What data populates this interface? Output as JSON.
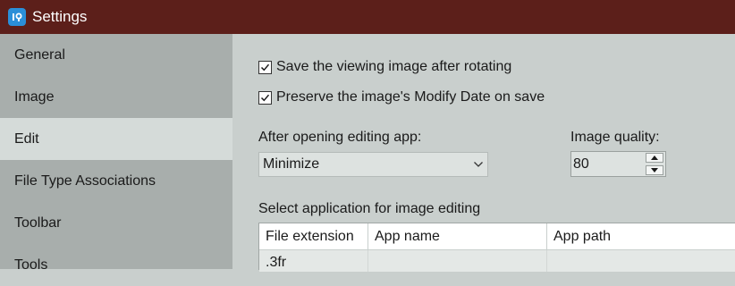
{
  "window": {
    "title": "Settings",
    "icon": "app-logo-icon"
  },
  "sidebar": {
    "items": [
      {
        "label": "General",
        "active": false
      },
      {
        "label": "Image",
        "active": false
      },
      {
        "label": "Edit",
        "active": true
      },
      {
        "label": "File Type Associations",
        "active": false
      },
      {
        "label": "Toolbar",
        "active": false
      },
      {
        "label": "Tools",
        "active": false
      }
    ]
  },
  "edit": {
    "save_after_rotating": {
      "label": "Save the viewing image after rotating",
      "checked": true
    },
    "preserve_modify_date": {
      "label": "Preserve the image's Modify Date on save",
      "checked": true
    },
    "after_opening": {
      "label": "After opening editing app:",
      "value": "Minimize"
    },
    "image_quality": {
      "label": "Image quality:",
      "value": "80"
    },
    "app_table": {
      "label": "Select application for image editing",
      "columns": [
        "File extension",
        "App name",
        "App path"
      ],
      "rows": [
        [
          ".3fr",
          "",
          ""
        ]
      ]
    }
  },
  "colors": {
    "titlebar": "#5c1f1a",
    "sidebar": "#a8aeac",
    "sidebar_active": "#d5dbd9",
    "content": "#c9cfcd"
  }
}
